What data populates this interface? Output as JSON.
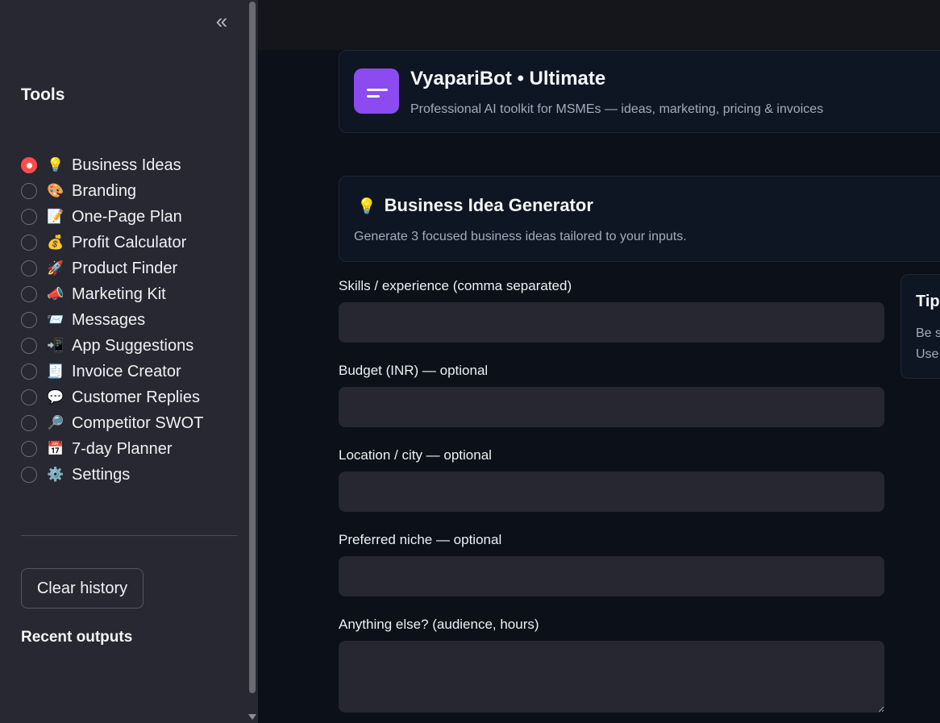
{
  "sidebar": {
    "collapse_icon": "«",
    "tools_heading": "Tools",
    "items": [
      {
        "emoji": "💡",
        "label": "Business Ideas",
        "selected": true
      },
      {
        "emoji": "🎨",
        "label": "Branding",
        "selected": false
      },
      {
        "emoji": "📝",
        "label": "One-Page Plan",
        "selected": false
      },
      {
        "emoji": "💰",
        "label": "Profit Calculator",
        "selected": false
      },
      {
        "emoji": "🚀",
        "label": "Product Finder",
        "selected": false
      },
      {
        "emoji": "📣",
        "label": "Marketing Kit",
        "selected": false
      },
      {
        "emoji": "📨",
        "label": "Messages",
        "selected": false
      },
      {
        "emoji": "📲",
        "label": "App Suggestions",
        "selected": false
      },
      {
        "emoji": "🧾",
        "label": "Invoice Creator",
        "selected": false
      },
      {
        "emoji": "💬",
        "label": "Customer Replies",
        "selected": false
      },
      {
        "emoji": "🔎",
        "label": "Competitor SWOT",
        "selected": false
      },
      {
        "emoji": "📅",
        "label": "7-day Planner",
        "selected": false
      },
      {
        "emoji": "⚙️",
        "label": "Settings",
        "selected": false
      }
    ],
    "clear_history_label": "Clear history",
    "recent_outputs_heading": "Recent outputs"
  },
  "header": {
    "title": "VyapariBot • Ultimate",
    "subtitle": "Professional AI toolkit for MSMEs — ideas, marketing, pricing & invoices"
  },
  "generator": {
    "emoji": "💡",
    "title": "Business Idea Generator",
    "subtitle": "Generate 3 focused business ideas tailored to your inputs."
  },
  "form": {
    "fields": [
      {
        "label": "Skills / experience (comma separated)",
        "value": ""
      },
      {
        "label": "Budget (INR) — optional",
        "value": ""
      },
      {
        "label": "Location / city — optional",
        "value": ""
      },
      {
        "label": "Preferred niche — optional",
        "value": ""
      },
      {
        "label": "Anything else? (audience, hours)",
        "value": ""
      }
    ]
  },
  "tips": {
    "title": "Tip",
    "line1": "Be s",
    "line2": "Use"
  },
  "colors": {
    "accent_red": "#ff4b4b",
    "logo_purple": "#8c4bf1",
    "sidebar_bg": "#272831",
    "main_bg": "#0b1019"
  }
}
